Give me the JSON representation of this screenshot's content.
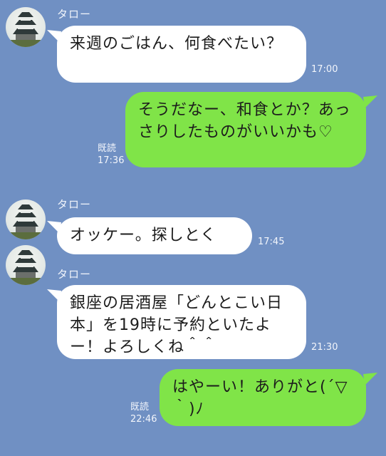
{
  "chat": {
    "messages": [
      {
        "sender": "タロー",
        "text": "来週のごはん、何食べたい？",
        "time": "17:00"
      },
      {
        "sender": "me",
        "text": "そうだなー、和食とか？あっさりしたものがいいかも♡",
        "read": "既読",
        "time": "17:36"
      },
      {
        "sender": "タロー",
        "text": "オッケー。探しとく",
        "time": "17:45"
      },
      {
        "sender": "タロー",
        "text": "銀座の居酒屋「どんとこい日本」を19時に予約といたよー！よろしくね＾＾",
        "time": "21:30"
      },
      {
        "sender": "me",
        "text": "はやーい！ありがと(´▽｀)ﾉ",
        "read": "既読",
        "time": "22:46"
      }
    ]
  },
  "colors": {
    "background": "#7090c3",
    "incoming_bubble": "#ffffff",
    "outgoing_bubble": "#80e448"
  },
  "icons": {
    "avatar": "castle-avatar-icon"
  }
}
